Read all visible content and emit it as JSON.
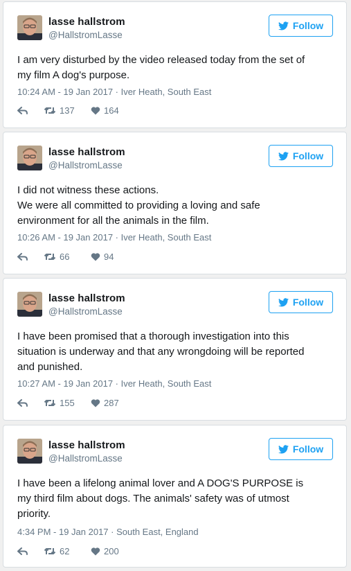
{
  "colors": {
    "accent": "#1da1f2",
    "muted": "#657786",
    "text": "#14171a"
  },
  "tweets": [
    {
      "name": "lasse hallstrom",
      "handle": "@HallstromLasse",
      "follow": "Follow",
      "text": "I am very disturbed by the video released today from the set of\nmy film A dog's purpose.",
      "meta": "10:24 AM - 19 Jan 2017 · Iver Heath, South East",
      "retweets": "137",
      "likes": "164"
    },
    {
      "name": "lasse hallstrom",
      "handle": "@HallstromLasse",
      "follow": "Follow",
      "text": "I did not witness these actions.\nWe were all committed to providing a loving and safe\nenvironment for all the animals in the film.",
      "meta": "10:26 AM - 19 Jan 2017 · Iver Heath, South East",
      "retweets": "66",
      "likes": "94"
    },
    {
      "name": "lasse hallstrom",
      "handle": "@HallstromLasse",
      "follow": "Follow",
      "text": "I have been promised that a thorough investigation into this\nsituation is underway and that any wrongdoing will be reported\nand punished.",
      "meta": "10:27 AM - 19 Jan 2017 · Iver Heath, South East",
      "retweets": "155",
      "likes": "287"
    },
    {
      "name": "lasse hallstrom",
      "handle": "@HallstromLasse",
      "follow": "Follow",
      "text": "I have been a lifelong animal lover and A DOG'S PURPOSE is\nmy third film about dogs. The animals' safety was of utmost\npriority.",
      "meta": "4:34 PM - 19 Jan 2017 · South East, England",
      "retweets": "62",
      "likes": "200"
    }
  ]
}
